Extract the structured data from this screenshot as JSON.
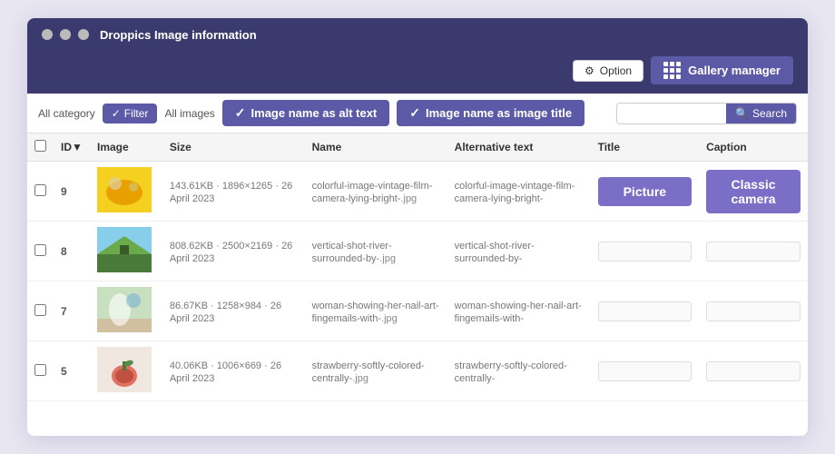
{
  "window": {
    "title": "Droppics Image information"
  },
  "toolbar": {
    "option_label": "Option",
    "gallery_manager_label": "Gallery manager"
  },
  "filter_bar": {
    "category_label": "All category",
    "filter_label": "Filter",
    "all_images_label": "All images",
    "alt_text_toggle": "Image name as alt text",
    "image_title_toggle": "Image name as image title",
    "search_placeholder": "",
    "search_label": "Search"
  },
  "table": {
    "columns": [
      "",
      "ID▼",
      "Image",
      "Size",
      "Name",
      "Alternative text",
      "Title",
      "Caption"
    ],
    "rows": [
      {
        "id": "9",
        "size": "143.61KB · 1896×1265 · 26 April 2023",
        "name": "colorful-image-vintage-film-camera-lying-bright-",
        "name_ext": ".jpg",
        "alt": "colorful-image-vintage-film-camera-lying-bright-",
        "title_value": "Picture",
        "title_highlight": true,
        "caption": "Classic camera",
        "caption_highlight": true,
        "thumb_color": "#f0c840",
        "thumb_type": "yellow"
      },
      {
        "id": "8",
        "size": "808.62KB · 2500×2169 · 26 April 2023",
        "name": "vertical-shot-river-surrounded-by-",
        "name_ext": ".jpg",
        "alt": "vertical-shot-river-surrounded-by-",
        "title_value": "",
        "title_highlight": false,
        "caption": "",
        "caption_highlight": false,
        "thumb_color": "#4a7a3a",
        "thumb_type": "green"
      },
      {
        "id": "7",
        "size": "86.67KB · 1258×984 · 26 April 2023",
        "name": "woman-showing-her-nail-art-fingemails-with-",
        "name_ext": ".jpg",
        "alt": "woman-showing-her-nail-art-fingemails-with-",
        "title_value": "",
        "title_highlight": false,
        "caption": "",
        "caption_highlight": false,
        "thumb_color": "#7ab0d0",
        "thumb_type": "blue"
      },
      {
        "id": "5",
        "size": "40.06KB · 1006×669 · 26 April 2023",
        "name": "strawberry-softly-colored-centrally-",
        "name_ext": ".jpg",
        "alt": "strawberry-softly-colored-centrally-",
        "title_value": "",
        "title_highlight": false,
        "caption": "",
        "caption_highlight": false,
        "thumb_color": "#e07060",
        "thumb_type": "red"
      }
    ]
  }
}
